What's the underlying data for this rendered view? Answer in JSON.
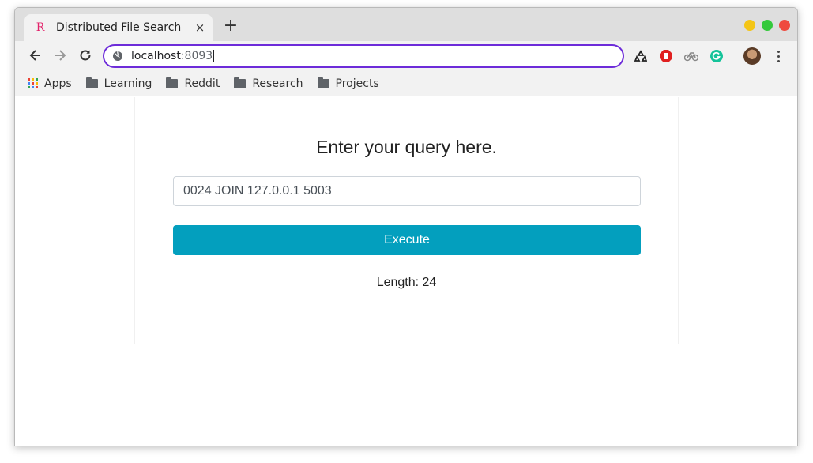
{
  "browser": {
    "tab": {
      "favicon": "R",
      "title": "Distributed File Search",
      "close": "×"
    },
    "new_tab": "+",
    "address": {
      "host": "localhost",
      "port": ":8093"
    },
    "bookmarks": [
      {
        "label": "Apps",
        "icon": "apps-grid-icon"
      },
      {
        "label": "Learning",
        "icon": "folder-icon"
      },
      {
        "label": "Reddit",
        "icon": "folder-icon"
      },
      {
        "label": "Research",
        "icon": "folder-icon"
      },
      {
        "label": "Projects",
        "icon": "folder-icon"
      }
    ],
    "window_controls": {
      "minimize": "#f4c516",
      "maximize": "#35c93c",
      "close": "#ef4a3e"
    }
  },
  "page": {
    "heading": "Enter your query here.",
    "query_value": "0024 JOIN 127.0.0.1 5003",
    "execute_label": "Execute",
    "length_text": "Length: 24",
    "accent_color": "#039fbe"
  }
}
